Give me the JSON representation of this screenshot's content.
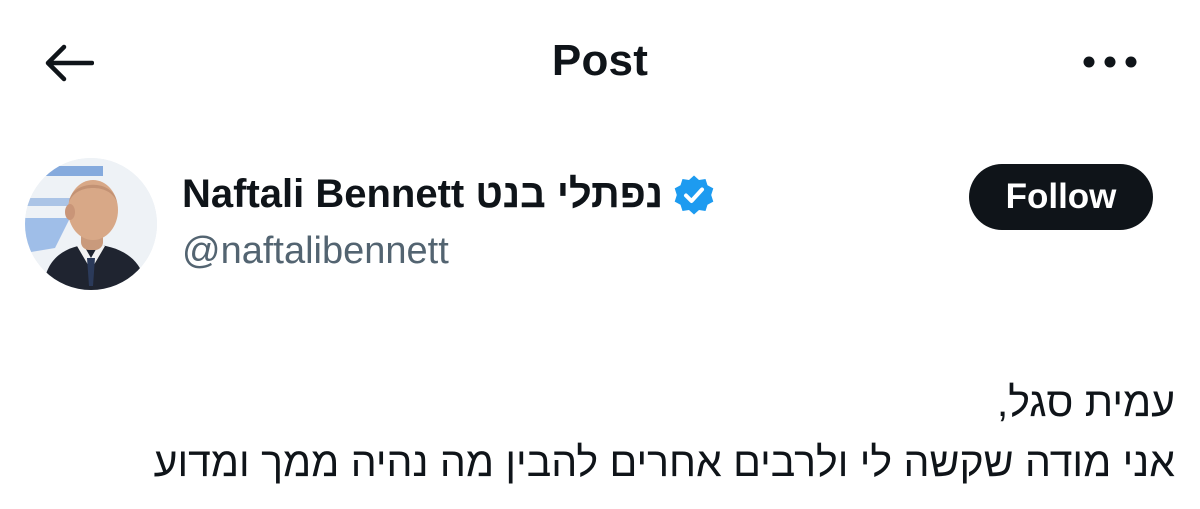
{
  "header": {
    "title": "Post",
    "back_icon": "arrow-left-icon",
    "more_icon": "more-horizontal-icon"
  },
  "author": {
    "display_name": "Naftali Bennett נפתלי בנט",
    "handle": "@naftalibennett",
    "verified_icon": "verified-badge-icon",
    "verified_color": "#1d9bf0",
    "follow_label": "Follow"
  },
  "post": {
    "lines": [
      "עמית סגל,",
      "אני מודה שקשה לי ולרבים אחרים להבין מה נהיה ממך ומדוע"
    ]
  }
}
